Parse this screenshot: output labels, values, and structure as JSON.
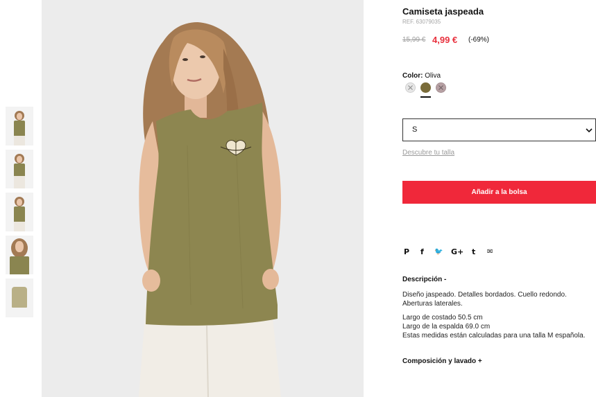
{
  "gallery": {
    "thumbnails": [
      "thumb-front",
      "thumb-full",
      "thumb-side",
      "thumb-closeup",
      "thumb-flat"
    ]
  },
  "product": {
    "title": "Camiseta jaspeada",
    "ref": "REF. 63079035",
    "price_old": "15,99 €",
    "price_new": "4,99 €",
    "discount": "(-69%)",
    "color_label": "Color:",
    "color_value": "Oliva",
    "swatches": [
      {
        "name": "light-grey",
        "hex": "#e7e7e7",
        "available": false
      },
      {
        "name": "oliva",
        "hex": "#7a6c3a",
        "available": true,
        "selected": true
      },
      {
        "name": "pink",
        "hex": "#b7a1a4",
        "available": false
      }
    ],
    "size_value": "S",
    "size_guide": "Descubre tu talla",
    "add_to_bag": "Añadir a la bolsa"
  },
  "share": {
    "icons": [
      "pinterest-icon",
      "facebook-icon",
      "twitter-icon",
      "google-plus-icon",
      "tumblr-icon",
      "email-icon"
    ],
    "pinterest": "P",
    "facebook": "f",
    "twitter": "🐦",
    "googleplus": "G+",
    "tumblr": "t",
    "email": "✉"
  },
  "description": {
    "heading": "Descripción -",
    "para1": "Diseño jaspeado. Detalles bordados. Cuello redondo. Aberturas laterales.",
    "line1": "Largo de costado 50.5 cm",
    "line2": "Largo de la espalda 69.0 cm",
    "line3": "Estas medidas están calculadas para una talla M española."
  },
  "composition": {
    "heading": "Composición y lavado +"
  },
  "colors": {
    "accent": "#f0283a",
    "sale_price": "#e8303d",
    "garment": "#8d8650"
  }
}
